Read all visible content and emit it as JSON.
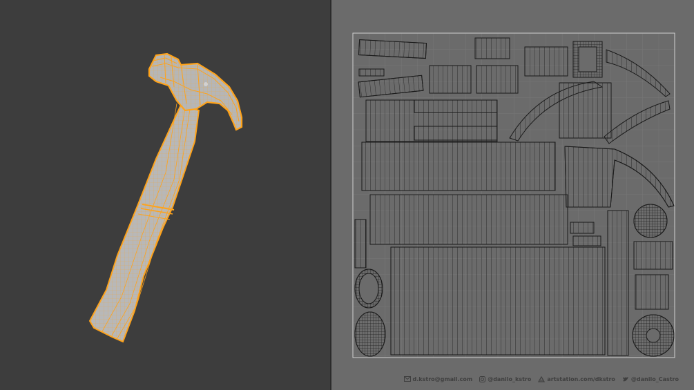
{
  "panels": {
    "left": "3d-viewport",
    "right": "uv-editor"
  },
  "colors": {
    "viewport_bg": "#3d3d3d",
    "uv_bg": "#6b6b6b",
    "uv_grid": "#777777",
    "uv_wire": "#202020",
    "mesh_fill": "#b6b6b6",
    "selection": "#ffa31a"
  },
  "footer": {
    "email": "d.kstro@gmail.com",
    "instagram": "@danilo_kstro",
    "artstation": "artstation.com/dkstro",
    "twitter": "@danilo_Castro"
  },
  "icons": [
    "mail-icon",
    "instagram-icon",
    "artstation-icon",
    "twitter-icon"
  ]
}
